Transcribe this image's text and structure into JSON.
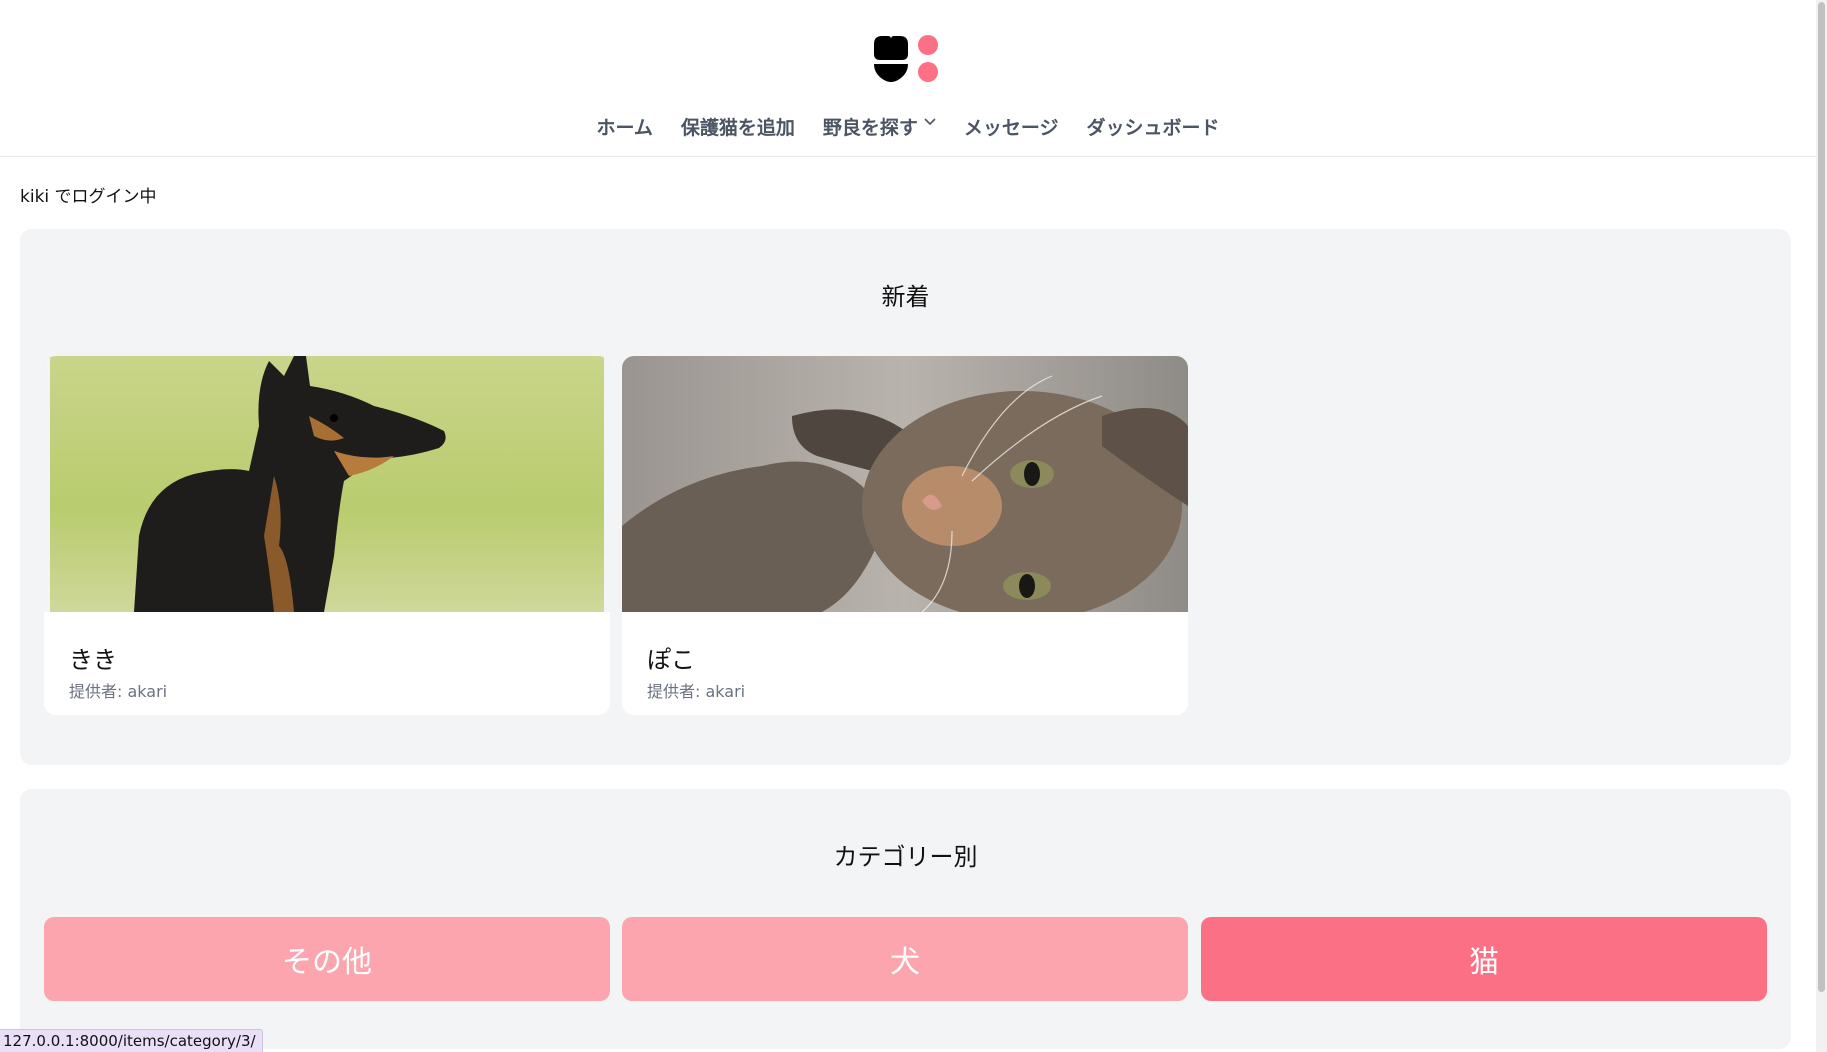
{
  "header": {
    "nav": [
      {
        "label": "ホーム"
      },
      {
        "label": "保護猫を追加"
      },
      {
        "label": "野良を探す",
        "has_dropdown": true
      },
      {
        "label": "メッセージ"
      },
      {
        "label": "ダッシュボード"
      }
    ]
  },
  "login_status": "kiki でログイン中",
  "new_section": {
    "title": "新着",
    "cards": [
      {
        "name": "きき",
        "provider": "提供者: akari",
        "image": "dog-photo"
      },
      {
        "name": "ぽこ",
        "provider": "提供者: akari",
        "image": "cat-photo"
      }
    ]
  },
  "category_section": {
    "title": "カテゴリー別",
    "categories": [
      {
        "label": "その他"
      },
      {
        "label": "犬"
      },
      {
        "label": "猫"
      }
    ]
  },
  "colors": {
    "accent": "#fb7085",
    "accent_light": "#fca5ae",
    "panel_bg": "#f3f4f6"
  },
  "status_bar_url": "127.0.0.1:8000/items/category/3/"
}
